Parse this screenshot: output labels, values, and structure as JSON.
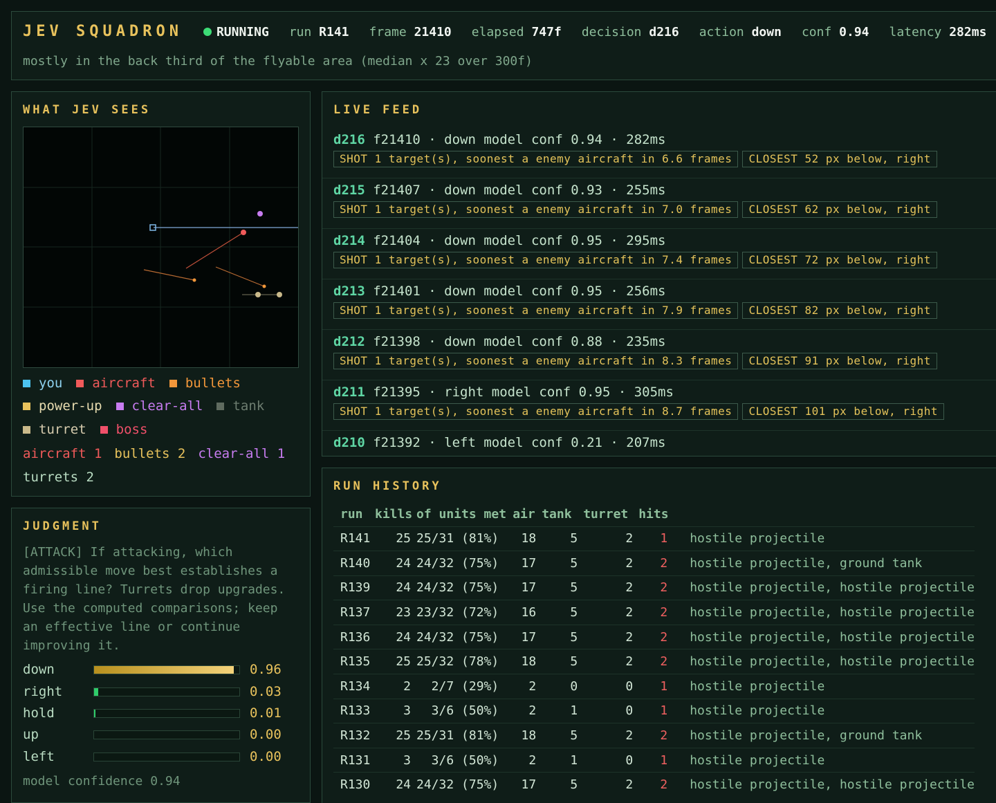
{
  "header": {
    "title": "JEV SQUADRON",
    "status": "RUNNING",
    "stats": [
      {
        "label": "run",
        "value": "R141"
      },
      {
        "label": "frame",
        "value": "21410"
      },
      {
        "label": "elapsed",
        "value": "747f"
      },
      {
        "label": "decision",
        "value": "d216"
      },
      {
        "label": "action",
        "value": "down"
      },
      {
        "label": "conf",
        "value": "0.94"
      },
      {
        "label": "latency",
        "value": "282ms"
      }
    ],
    "subtitle": "mostly in the back third of the flyable area (median x 23 over 300f)"
  },
  "sees": {
    "title": "WHAT JEV SEES",
    "legend": [
      {
        "label": "you",
        "color": "#4cc3f0"
      },
      {
        "label": "aircraft",
        "color": "#f05a5a"
      },
      {
        "label": "bullets",
        "color": "#f2973a"
      },
      {
        "label": "power-up",
        "color": "#e8c25c"
      },
      {
        "label": "clear-all",
        "color": "#c77cf0"
      },
      {
        "label": "tank",
        "color": "#5f6b5f"
      },
      {
        "label": "turret",
        "color": "#c9b98a"
      },
      {
        "label": "boss",
        "color": "#f0506a"
      }
    ],
    "counts": [
      {
        "label": "aircraft 1",
        "color": "#f05a5a"
      },
      {
        "label": "bullets 2",
        "color": "#e8c25c"
      },
      {
        "label": "clear-all 1",
        "color": "#c77cf0"
      }
    ],
    "counts2": "turrets 2"
  },
  "judgment": {
    "title": "JUDGMENT",
    "text": "[ATTACK] If attacking, which admissible move best establishes a firing line? Turrets drop upgrades. Use the computed comparisons; keep an effective line or continue improving it.",
    "actions": [
      {
        "label": "down",
        "value": "0.96",
        "prob": 0.96
      },
      {
        "label": "right",
        "value": "0.03",
        "prob": 0.03
      },
      {
        "label": "hold",
        "value": "0.01",
        "prob": 0.01
      },
      {
        "label": "up",
        "value": "0.00",
        "prob": 0.0
      },
      {
        "label": "left",
        "value": "0.00",
        "prob": 0.0
      }
    ],
    "confidence": "model confidence 0.94"
  },
  "feed": {
    "title": "LIVE FEED",
    "items": [
      {
        "id": "d216",
        "rest": "f21410 · down model conf 0.94 · 282ms",
        "shot": "SHOT 1 target(s), soonest a enemy aircraft in 6.6 frames",
        "closest": "CLOSEST 52 px below, right"
      },
      {
        "id": "d215",
        "rest": "f21407 · down model conf 0.93 · 255ms",
        "shot": "SHOT 1 target(s), soonest a enemy aircraft in 7.0 frames",
        "closest": "CLOSEST 62 px below, right"
      },
      {
        "id": "d214",
        "rest": "f21404 · down model conf 0.95 · 295ms",
        "shot": "SHOT 1 target(s), soonest a enemy aircraft in 7.4 frames",
        "closest": "CLOSEST 72 px below, right"
      },
      {
        "id": "d213",
        "rest": "f21401 · down model conf 0.95 · 256ms",
        "shot": "SHOT 1 target(s), soonest a enemy aircraft in 7.9 frames",
        "closest": "CLOSEST 82 px below, right"
      },
      {
        "id": "d212",
        "rest": "f21398 · down model conf 0.88 · 235ms",
        "shot": "SHOT 1 target(s), soonest a enemy aircraft in 8.3 frames",
        "closest": "CLOSEST 91 px below, right"
      },
      {
        "id": "d211",
        "rest": "f21395 · right model conf 0.95 · 305ms",
        "shot": "SHOT 1 target(s), soonest a enemy aircraft in 8.7 frames",
        "closest": "CLOSEST 101 px below, right"
      },
      {
        "id": "d210",
        "rest": "f21392 · left model conf 0.21 · 207ms",
        "shot": "",
        "closest": ""
      }
    ]
  },
  "history": {
    "title": "RUN HISTORY",
    "columns": [
      "run",
      "kills",
      "of units met",
      "air",
      "tank",
      "turret",
      "hits"
    ],
    "rows": [
      [
        "R141",
        "25",
        "25/31 (81%)",
        "18",
        "5",
        "2",
        "1",
        "hostile projectile"
      ],
      [
        "R140",
        "24",
        "24/32 (75%)",
        "17",
        "5",
        "2",
        "2",
        "hostile projectile, ground tank"
      ],
      [
        "R139",
        "24",
        "24/32 (75%)",
        "17",
        "5",
        "2",
        "2",
        "hostile projectile, hostile projectile"
      ],
      [
        "R137",
        "23",
        "23/32 (72%)",
        "16",
        "5",
        "2",
        "2",
        "hostile projectile, hostile projectile"
      ],
      [
        "R136",
        "24",
        "24/32 (75%)",
        "17",
        "5",
        "2",
        "2",
        "hostile projectile, hostile projectile"
      ],
      [
        "R135",
        "25",
        "25/32 (78%)",
        "18",
        "5",
        "2",
        "2",
        "hostile projectile, hostile projectile"
      ],
      [
        "R134",
        "2",
        "2/7 (29%)",
        "2",
        "0",
        "0",
        "1",
        "hostile projectile"
      ],
      [
        "R133",
        "3",
        "3/6 (50%)",
        "2",
        "1",
        "0",
        "1",
        "hostile projectile"
      ],
      [
        "R132",
        "25",
        "25/31 (81%)",
        "18",
        "5",
        "2",
        "2",
        "hostile projectile, ground tank"
      ],
      [
        "R131",
        "3",
        "3/6 (50%)",
        "2",
        "1",
        "0",
        "1",
        "hostile projectile"
      ],
      [
        "R130",
        "24",
        "24/32 (75%)",
        "17",
        "5",
        "2",
        "2",
        "hostile projectile, hostile projectile"
      ]
    ]
  },
  "colors": {
    "accent": "#e8c25c",
    "running": "#3ddc76",
    "decision_id": "#5fd6a4",
    "hits": "#f06060"
  }
}
